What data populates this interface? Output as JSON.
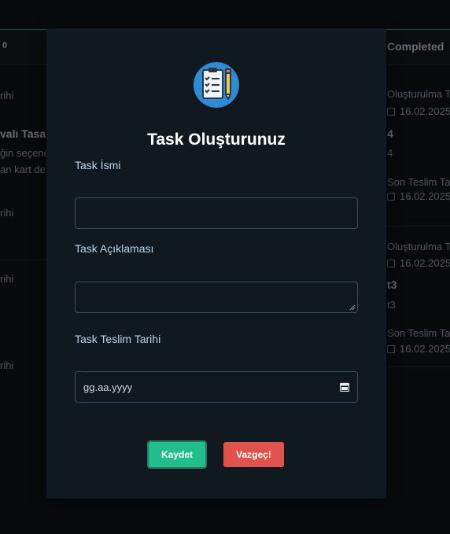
{
  "background": {
    "header_left": "0",
    "header_right": "Completed",
    "left_texts": [
      "rihi",
      "valı Tasarı",
      "ğin seçene",
      "an kart deta",
      "rihi",
      "rihi",
      "rihi"
    ],
    "right_cards": [
      {
        "created_label": "Oluşturulma Ta",
        "created_date": "16.02.2025",
        "title": "4",
        "desc": "4",
        "due_label": "Son Teslim Ta",
        "due_date": "16.02.2025"
      },
      {
        "created_label": "Oluşturulma Ta",
        "created_date": "16.02.2025",
        "title": "t3",
        "desc": "t3",
        "due_label": "Son Teslim Ta",
        "due_date": "16.02.2025"
      }
    ]
  },
  "modal": {
    "icon": "checklist-clipboard-icon",
    "title": "Task Oluşturunuz",
    "name_label": "Task İsmi",
    "name_value": "",
    "desc_label": "Task Açıklaması",
    "desc_value": "",
    "due_label": "Task Teslim Tarihi",
    "due_placeholder": "gg.aa.yyyy",
    "calendar_icon": "calendar-icon",
    "save_label": "Kaydet",
    "cancel_label": "Vazgeç!"
  },
  "colors": {
    "modal_bg": "#111920",
    "save": "#1fbe8a",
    "cancel": "#e2524c",
    "label": "#b9d6ef"
  }
}
